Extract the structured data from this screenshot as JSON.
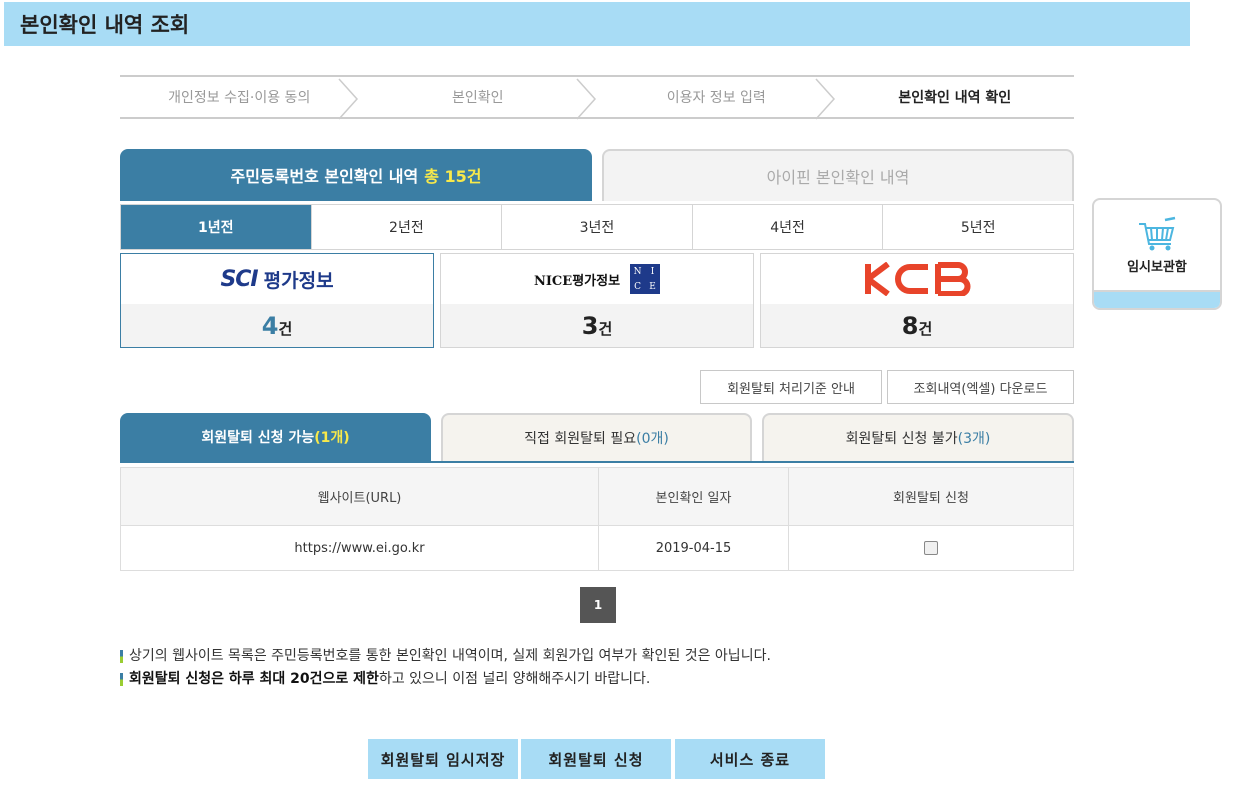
{
  "page_title": "본인확인 내역 조회",
  "steps": [
    {
      "label": "개인정보 수집·이용 동의",
      "active": false
    },
    {
      "label": "본인확인",
      "active": false
    },
    {
      "label": "이용자 정보 입력",
      "active": false
    },
    {
      "label": "본인확인 내역 확인",
      "active": true
    }
  ],
  "main_tabs": {
    "resident": {
      "label": "주민등록번호 본인확인 내역",
      "count": "총 15건"
    },
    "ipin": {
      "label": "아이핀 본인확인 내역"
    }
  },
  "years": [
    "1년전",
    "2년전",
    "3년전",
    "4년전",
    "5년전"
  ],
  "agencies": [
    {
      "logo_text_a": "SCI",
      "logo_text_b": "평가정보",
      "count": "4",
      "unit": "건"
    },
    {
      "logo_text_a": "NICE평가정보",
      "logo_box": [
        "N",
        "I",
        "C",
        "E"
      ],
      "count": "3",
      "unit": "건"
    },
    {
      "logo_text_a": "KCB",
      "count": "8",
      "unit": "건"
    }
  ],
  "cart": {
    "label": "임시보관함",
    "icon": "cart-icon"
  },
  "actions": {
    "criteria": "회원탈퇴 처리기준 안내",
    "download": "조회내역(엑셀) 다운로드"
  },
  "sub_tabs": [
    {
      "label": "회원탈퇴 신청 가능",
      "count": "(1개)"
    },
    {
      "label": "직접 회원탈퇴 필요",
      "count": "(0개)"
    },
    {
      "label": "회원탈퇴 신청 불가",
      "count": "(3개)"
    }
  ],
  "table": {
    "headers": [
      "웹사이트(URL)",
      "본인확인 일자",
      "회원탈퇴 신청"
    ],
    "rows": [
      {
        "url": "https://www.ei.go.kr",
        "date": "2019-04-15",
        "checked": false
      }
    ]
  },
  "pagination": {
    "current": "1"
  },
  "notes": {
    "line1": "상기의 웹사이트 목록은 주민등록번호를 통한 본인확인 내역이며, 실제 회원가입 여부가 확인된 것은 아닙니다.",
    "line2_a": "회원탈퇴 신청은 하루 최대 20건으로 제한",
    "line2_b": "하고 있으니 이점 널리 양해해주시기 바랍니다."
  },
  "bottom_buttons": {
    "temp_save": "회원탈퇴 임시저장",
    "apply": "회원탈퇴 신청",
    "exit": "서비스 종료"
  },
  "colors": {
    "primary": "#3b7ea4",
    "highlight": "#f8e94a",
    "banner": "#a8dcf5",
    "kcb": "#e8442a"
  }
}
